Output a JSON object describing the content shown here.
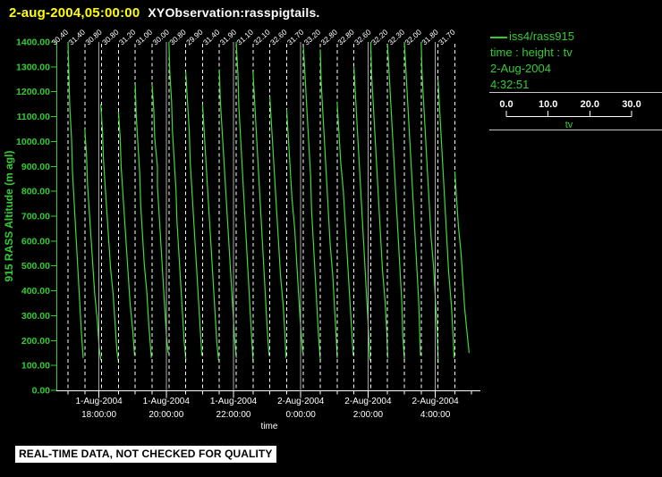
{
  "title": {
    "timestamp": "2-aug-2004,05:00:00",
    "plot_name": "XYObservation:rasspigtails."
  },
  "legend": {
    "series_label": "iss4/rass915",
    "fields_label": "time : height : tv",
    "date": "2-Aug-2004",
    "time": "4:32:51"
  },
  "tv_scale": {
    "ticks": [
      "0.0",
      "10.0",
      "20.0",
      "30.0"
    ],
    "label": "tv"
  },
  "banner": {
    "text": "REAL-TIME DATA, NOT CHECKED FOR QUALITY"
  },
  "colors": {
    "green": "#33cc33",
    "trace_green": "#3bdc3b",
    "yellow": "#ffff00",
    "white": "#ffffff",
    "grid_gray": "#a8a8a8",
    "separator_gray": "#c8c8c8",
    "background": "#000000"
  },
  "chart_data": {
    "type": "line",
    "xlabel": "time",
    "ylabel": "915 RASS Altitude (m agl)",
    "ylim": [
      0,
      1400
    ],
    "ytick_labels": [
      "0.00",
      "100.00",
      "200.00",
      "300.00",
      "400.00",
      "500.00",
      "600.00",
      "700.00",
      "800.00",
      "900.00",
      "1000.00",
      "1100.00",
      "1200.00",
      "1300.00",
      "1400.00"
    ],
    "xtick_labels": [
      {
        "date": "1-Aug-2004",
        "time": "18:00:00"
      },
      {
        "date": "1-Aug-2004",
        "time": "20:00:00"
      },
      {
        "date": "1-Aug-2004",
        "time": "22:00:00"
      },
      {
        "date": "2-Aug-2004",
        "time": "0:00:00"
      },
      {
        "date": "2-Aug-2004",
        "time": "2:00:00"
      },
      {
        "date": "2-Aug-2004",
        "time": "4:00:00"
      }
    ],
    "profiles": [
      {
        "tv_top_label": "30.40",
        "gridline": false,
        "trace": [
          [
            1400,
            0
          ],
          [
            1270,
            1
          ],
          [
            1140,
            2
          ],
          [
            1010,
            4
          ],
          [
            880,
            5
          ],
          [
            750,
            7
          ],
          [
            620,
            9
          ],
          [
            490,
            11
          ],
          [
            360,
            13
          ],
          [
            230,
            15
          ],
          [
            130,
            17
          ]
        ]
      },
      {
        "tv_top_label": "31.40",
        "gridline": false,
        "trace": [
          [
            1050,
            0
          ],
          [
            940,
            2
          ],
          [
            830,
            3
          ],
          [
            720,
            5
          ],
          [
            610,
            7
          ],
          [
            500,
            9
          ],
          [
            390,
            11
          ],
          [
            280,
            14
          ],
          [
            170,
            16
          ],
          [
            120,
            18
          ]
        ]
      },
      {
        "tv_top_label": "30.80",
        "gridline": true,
        "trace": [
          [
            1150,
            -1
          ],
          [
            1040,
            1
          ],
          [
            930,
            2
          ],
          [
            820,
            4
          ],
          [
            710,
            6
          ],
          [
            600,
            8
          ],
          [
            490,
            10
          ],
          [
            380,
            13
          ],
          [
            270,
            15
          ],
          [
            160,
            17
          ],
          [
            110,
            19
          ]
        ]
      },
      {
        "tv_top_label": "30.80",
        "gridline": false,
        "trace": [
          [
            1120,
            0
          ],
          [
            1010,
            2
          ],
          [
            900,
            3
          ],
          [
            790,
            5
          ],
          [
            680,
            7
          ],
          [
            570,
            9
          ],
          [
            460,
            11
          ],
          [
            350,
            13
          ],
          [
            240,
            16
          ],
          [
            140,
            18
          ]
        ]
      },
      {
        "tv_top_label": "31.20",
        "gridline": false,
        "trace": [
          [
            1230,
            0
          ],
          [
            1110,
            1
          ],
          [
            990,
            3
          ],
          [
            870,
            5
          ],
          [
            750,
            6
          ],
          [
            630,
            8
          ],
          [
            510,
            10
          ],
          [
            390,
            13
          ],
          [
            270,
            15
          ],
          [
            130,
            18
          ]
        ]
      },
      {
        "tv_top_label": "31.00",
        "gridline": false,
        "trace": [
          [
            1230,
            0
          ],
          [
            1120,
            2
          ],
          [
            1010,
            3
          ],
          [
            900,
            6
          ],
          [
            820,
            6
          ],
          [
            700,
            8
          ],
          [
            580,
            10
          ],
          [
            460,
            12
          ],
          [
            340,
            14
          ],
          [
            220,
            16
          ],
          [
            150,
            18
          ]
        ]
      },
      {
        "tv_top_label": "30.00",
        "gridline": true,
        "trace": [
          [
            1400,
            0
          ],
          [
            1280,
            1
          ],
          [
            1160,
            3
          ],
          [
            1040,
            4
          ],
          [
            920,
            6
          ],
          [
            800,
            8
          ],
          [
            680,
            9
          ],
          [
            560,
            11
          ],
          [
            440,
            13
          ],
          [
            320,
            15
          ],
          [
            200,
            17
          ],
          [
            120,
            19
          ]
        ]
      },
      {
        "tv_top_label": "30.80",
        "gridline": false,
        "trace": [
          [
            1280,
            0
          ],
          [
            1160,
            2
          ],
          [
            1040,
            4
          ],
          [
            920,
            5
          ],
          [
            800,
            7
          ],
          [
            680,
            9
          ],
          [
            560,
            11
          ],
          [
            440,
            13
          ],
          [
            320,
            15
          ],
          [
            200,
            17
          ],
          [
            140,
            18
          ]
        ]
      },
      {
        "tv_top_label": "29.90",
        "gridline": false,
        "trace": [
          [
            1150,
            0
          ],
          [
            1030,
            2
          ],
          [
            910,
            4
          ],
          [
            790,
            6
          ],
          [
            670,
            8
          ],
          [
            550,
            10
          ],
          [
            430,
            12
          ],
          [
            310,
            14
          ],
          [
            190,
            16
          ],
          [
            120,
            18
          ]
        ]
      },
      {
        "tv_top_label": "31.40",
        "gridline": false,
        "trace": [
          [
            1290,
            0
          ],
          [
            1170,
            1
          ],
          [
            1050,
            3
          ],
          [
            930,
            5
          ],
          [
            810,
            7
          ],
          [
            690,
            9
          ],
          [
            570,
            11
          ],
          [
            450,
            13
          ],
          [
            330,
            15
          ],
          [
            210,
            17
          ],
          [
            130,
            19
          ]
        ]
      },
      {
        "tv_top_label": "31.90",
        "gridline": true,
        "trace": [
          [
            1400,
            0
          ],
          [
            1270,
            2
          ],
          [
            1140,
            3
          ],
          [
            1010,
            5
          ],
          [
            880,
            7
          ],
          [
            750,
            9
          ],
          [
            620,
            11
          ],
          [
            490,
            13
          ],
          [
            360,
            15
          ],
          [
            230,
            17
          ],
          [
            110,
            19
          ]
        ]
      },
      {
        "tv_top_label": "31.10",
        "gridline": false,
        "trace": [
          [
            1280,
            0
          ],
          [
            1150,
            2
          ],
          [
            1020,
            4
          ],
          [
            890,
            6
          ],
          [
            760,
            8
          ],
          [
            630,
            10
          ],
          [
            500,
            12
          ],
          [
            370,
            14
          ],
          [
            240,
            16
          ],
          [
            140,
            18
          ]
        ]
      },
      {
        "tv_top_label": "32.10",
        "gridline": false,
        "trace": [
          [
            1180,
            0
          ],
          [
            1060,
            2
          ],
          [
            940,
            4
          ],
          [
            820,
            6
          ],
          [
            700,
            8
          ],
          [
            580,
            10
          ],
          [
            460,
            12
          ],
          [
            340,
            15
          ],
          [
            220,
            17
          ],
          [
            130,
            18
          ]
        ]
      },
      {
        "tv_top_label": "32.60",
        "gridline": false,
        "trace": [
          [
            1130,
            0
          ],
          [
            1010,
            2
          ],
          [
            890,
            4
          ],
          [
            770,
            6
          ],
          [
            650,
            9
          ],
          [
            530,
            11
          ],
          [
            410,
            13
          ],
          [
            290,
            15
          ],
          [
            150,
            18
          ]
        ]
      },
      {
        "tv_top_label": "31.70",
        "gridline": true,
        "trace": [
          [
            1380,
            0
          ],
          [
            1250,
            2
          ],
          [
            1120,
            4
          ],
          [
            990,
            6
          ],
          [
            860,
            8
          ],
          [
            730,
            9
          ],
          [
            600,
            11
          ],
          [
            470,
            13
          ],
          [
            340,
            15
          ],
          [
            210,
            17
          ],
          [
            120,
            19
          ]
        ]
      },
      {
        "tv_top_label": "33.20",
        "gridline": false,
        "trace": [
          [
            1370,
            0
          ],
          [
            1240,
            1
          ],
          [
            1110,
            3
          ],
          [
            980,
            5
          ],
          [
            850,
            7
          ],
          [
            720,
            9
          ],
          [
            590,
            11
          ],
          [
            460,
            14
          ],
          [
            330,
            16
          ],
          [
            200,
            18
          ],
          [
            130,
            19
          ]
        ]
      },
      {
        "tv_top_label": "32.80",
        "gridline": false,
        "trace": [
          [
            1160,
            0
          ],
          [
            1040,
            2
          ],
          [
            920,
            4
          ],
          [
            800,
            7
          ],
          [
            680,
            9
          ],
          [
            560,
            11
          ],
          [
            440,
            13
          ],
          [
            320,
            15
          ],
          [
            200,
            17
          ],
          [
            140,
            18
          ]
        ]
      },
      {
        "tv_top_label": "32.80",
        "gridline": false,
        "trace": [
          [
            1300,
            0
          ],
          [
            1170,
            2
          ],
          [
            1040,
            4
          ],
          [
            910,
            6
          ],
          [
            780,
            8
          ],
          [
            650,
            10
          ],
          [
            520,
            12
          ],
          [
            390,
            14
          ],
          [
            260,
            16
          ],
          [
            120,
            18
          ]
        ]
      },
      {
        "tv_top_label": "32.60",
        "gridline": true,
        "trace": [
          [
            1400,
            0
          ],
          [
            1270,
            1
          ],
          [
            1140,
            3
          ],
          [
            1010,
            5
          ],
          [
            880,
            7
          ],
          [
            750,
            9
          ],
          [
            620,
            11
          ],
          [
            490,
            13
          ],
          [
            360,
            16
          ],
          [
            230,
            18
          ],
          [
            130,
            19
          ]
        ]
      },
      {
        "tv_top_label": "32.20",
        "gridline": false,
        "trace": [
          [
            1390,
            0
          ],
          [
            1260,
            2
          ],
          [
            1130,
            4
          ],
          [
            1000,
            6
          ],
          [
            870,
            8
          ],
          [
            740,
            10
          ],
          [
            610,
            12
          ],
          [
            480,
            14
          ],
          [
            350,
            16
          ],
          [
            220,
            17
          ],
          [
            120,
            19
          ]
        ]
      },
      {
        "tv_top_label": "32.30",
        "gridline": false,
        "trace": [
          [
            1400,
            0
          ],
          [
            1270,
            2
          ],
          [
            1140,
            4
          ],
          [
            1010,
            6
          ],
          [
            880,
            8
          ],
          [
            750,
            10
          ],
          [
            620,
            12
          ],
          [
            490,
            14
          ],
          [
            360,
            16
          ],
          [
            140,
            18
          ]
        ]
      },
      {
        "tv_top_label": "32.00",
        "gridline": false,
        "trace": [
          [
            1400,
            0
          ],
          [
            1270,
            1
          ],
          [
            1140,
            3
          ],
          [
            1010,
            5
          ],
          [
            880,
            7
          ],
          [
            750,
            9
          ],
          [
            620,
            11
          ],
          [
            490,
            14
          ],
          [
            360,
            16
          ],
          [
            230,
            18
          ],
          [
            110,
            19
          ]
        ]
      },
      {
        "tv_top_label": "31.80",
        "gridline": true,
        "trace": [
          [
            1250,
            0
          ],
          [
            1120,
            2
          ],
          [
            990,
            4
          ],
          [
            860,
            6
          ],
          [
            730,
            8
          ],
          [
            600,
            10
          ],
          [
            470,
            12
          ],
          [
            340,
            15
          ],
          [
            210,
            17
          ],
          [
            130,
            18
          ]
        ]
      },
      {
        "tv_top_label": "31.70",
        "gridline": false,
        "trace": [
          [
            880,
            0
          ],
          [
            770,
            2
          ],
          [
            660,
            4
          ],
          [
            550,
            7
          ],
          [
            440,
            9
          ],
          [
            330,
            11
          ],
          [
            220,
            14
          ],
          [
            150,
            16
          ]
        ]
      }
    ]
  }
}
